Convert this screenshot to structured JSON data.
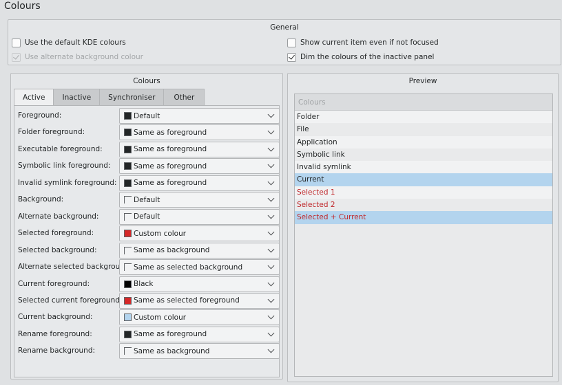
{
  "window": {
    "title": "Colours"
  },
  "general": {
    "title": "General",
    "options": [
      {
        "label": "Use the default KDE colours",
        "checked": false,
        "disabled": false
      },
      {
        "label": "Show current item even if not focused",
        "checked": false,
        "disabled": false
      },
      {
        "label": "Use alternate background colour",
        "checked": true,
        "disabled": true
      },
      {
        "label": "Dim the colours of the inactive panel",
        "checked": true,
        "disabled": false
      }
    ]
  },
  "colours": {
    "title": "Colours",
    "tabs": [
      "Active",
      "Inactive",
      "Synchroniser",
      "Other"
    ],
    "active_tab": "Active",
    "rows": [
      {
        "label": "Foreground:",
        "value": "Default",
        "swatch": "#232627"
      },
      {
        "label": "Folder foreground:",
        "value": "Same as foreground",
        "swatch": "#232627"
      },
      {
        "label": "Executable foreground:",
        "value": "Same as foreground",
        "swatch": "#232627"
      },
      {
        "label": "Symbolic link foreground:",
        "value": "Same as foreground",
        "swatch": "#232627"
      },
      {
        "label": "Invalid symlink foreground:",
        "value": "Same as foreground",
        "swatch": "#232627"
      },
      {
        "label": "Background:",
        "value": "Default",
        "swatch": "none"
      },
      {
        "label": "Alternate background:",
        "value": "Default",
        "swatch": "none"
      },
      {
        "label": "Selected foreground:",
        "value": "Custom colour",
        "swatch": "#d62828"
      },
      {
        "label": "Selected background:",
        "value": "Same as background",
        "swatch": "none"
      },
      {
        "label": "Alternate selected background:",
        "value": "Same as selected background",
        "swatch": "none"
      },
      {
        "label": "Current foreground:",
        "value": "Black",
        "swatch": "#000000"
      },
      {
        "label": "Selected current foreground:",
        "value": "Same as selected foreground",
        "swatch": "#d62828"
      },
      {
        "label": "Current background:",
        "value": "Custom colour",
        "swatch": "#b3d4ee"
      },
      {
        "label": "Rename foreground:",
        "value": "Same as foreground",
        "swatch": "#232627"
      },
      {
        "label": "Rename background:",
        "value": "Same as background",
        "swatch": "none"
      }
    ]
  },
  "preview": {
    "title": "Preview",
    "header": "Colours",
    "items": [
      {
        "label": "Folder",
        "color": "#232627",
        "background": "#f1f2f3"
      },
      {
        "label": "File",
        "color": "#232627",
        "background": "#e9eaeb"
      },
      {
        "label": "Application",
        "color": "#232627",
        "background": "#f1f2f3"
      },
      {
        "label": "Symbolic link",
        "color": "#232627",
        "background": "#e9eaeb"
      },
      {
        "label": "Invalid symlink",
        "color": "#232627",
        "background": "#f1f2f3"
      },
      {
        "label": "Current",
        "color": "#232627",
        "background": "#b3d4ee"
      },
      {
        "label": "Selected 1",
        "color": "#c0282b",
        "background": "#f1f2f3"
      },
      {
        "label": "Selected 2",
        "color": "#c0282b",
        "background": "#e9eaeb"
      },
      {
        "label": "Selected + Current",
        "color": "#c0282b",
        "background": "#b3d4ee"
      }
    ]
  }
}
